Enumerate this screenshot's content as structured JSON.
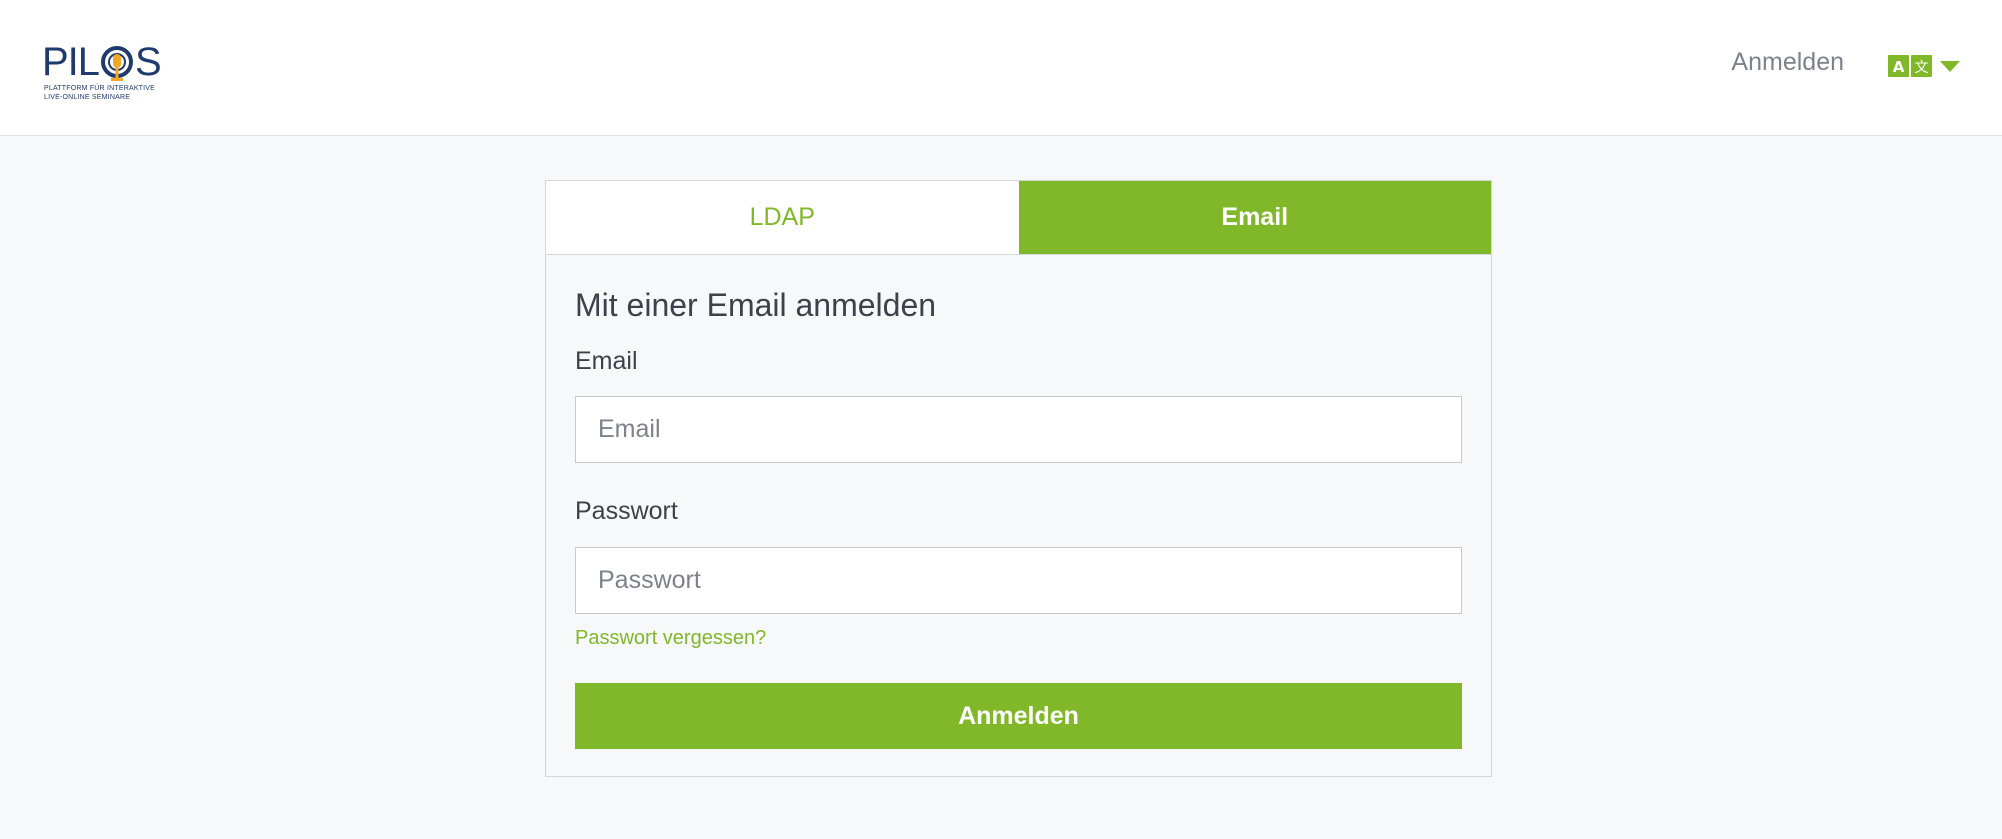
{
  "brand": {
    "logo_word_left": "PIL",
    "logo_word_right": "S",
    "tagline_line1": "Plattform für interaktive",
    "tagline_line2": "Live-Online Seminare",
    "logo_color": "#1f3a6e",
    "logo_accent": "#f5a623"
  },
  "header": {
    "login_link": "Anmelden",
    "language_icon": "language-translate-icon",
    "language_badge_left": "A",
    "language_badge_right": "文"
  },
  "tabs": [
    {
      "label": "LDAP",
      "active": false
    },
    {
      "label": "Email",
      "active": true
    }
  ],
  "form": {
    "title": "Mit einer Email anmelden",
    "email_label": "Email",
    "email_placeholder": "Email",
    "email_value": "",
    "password_label": "Passwort",
    "password_placeholder": "Passwort",
    "password_value": "",
    "forgot_link": "Passwort vergessen?",
    "submit_label": "Anmelden"
  },
  "colors": {
    "accent": "#80b82a",
    "text": "#3d4149",
    "muted": "#7d828b",
    "background": "#f7f8fa"
  }
}
